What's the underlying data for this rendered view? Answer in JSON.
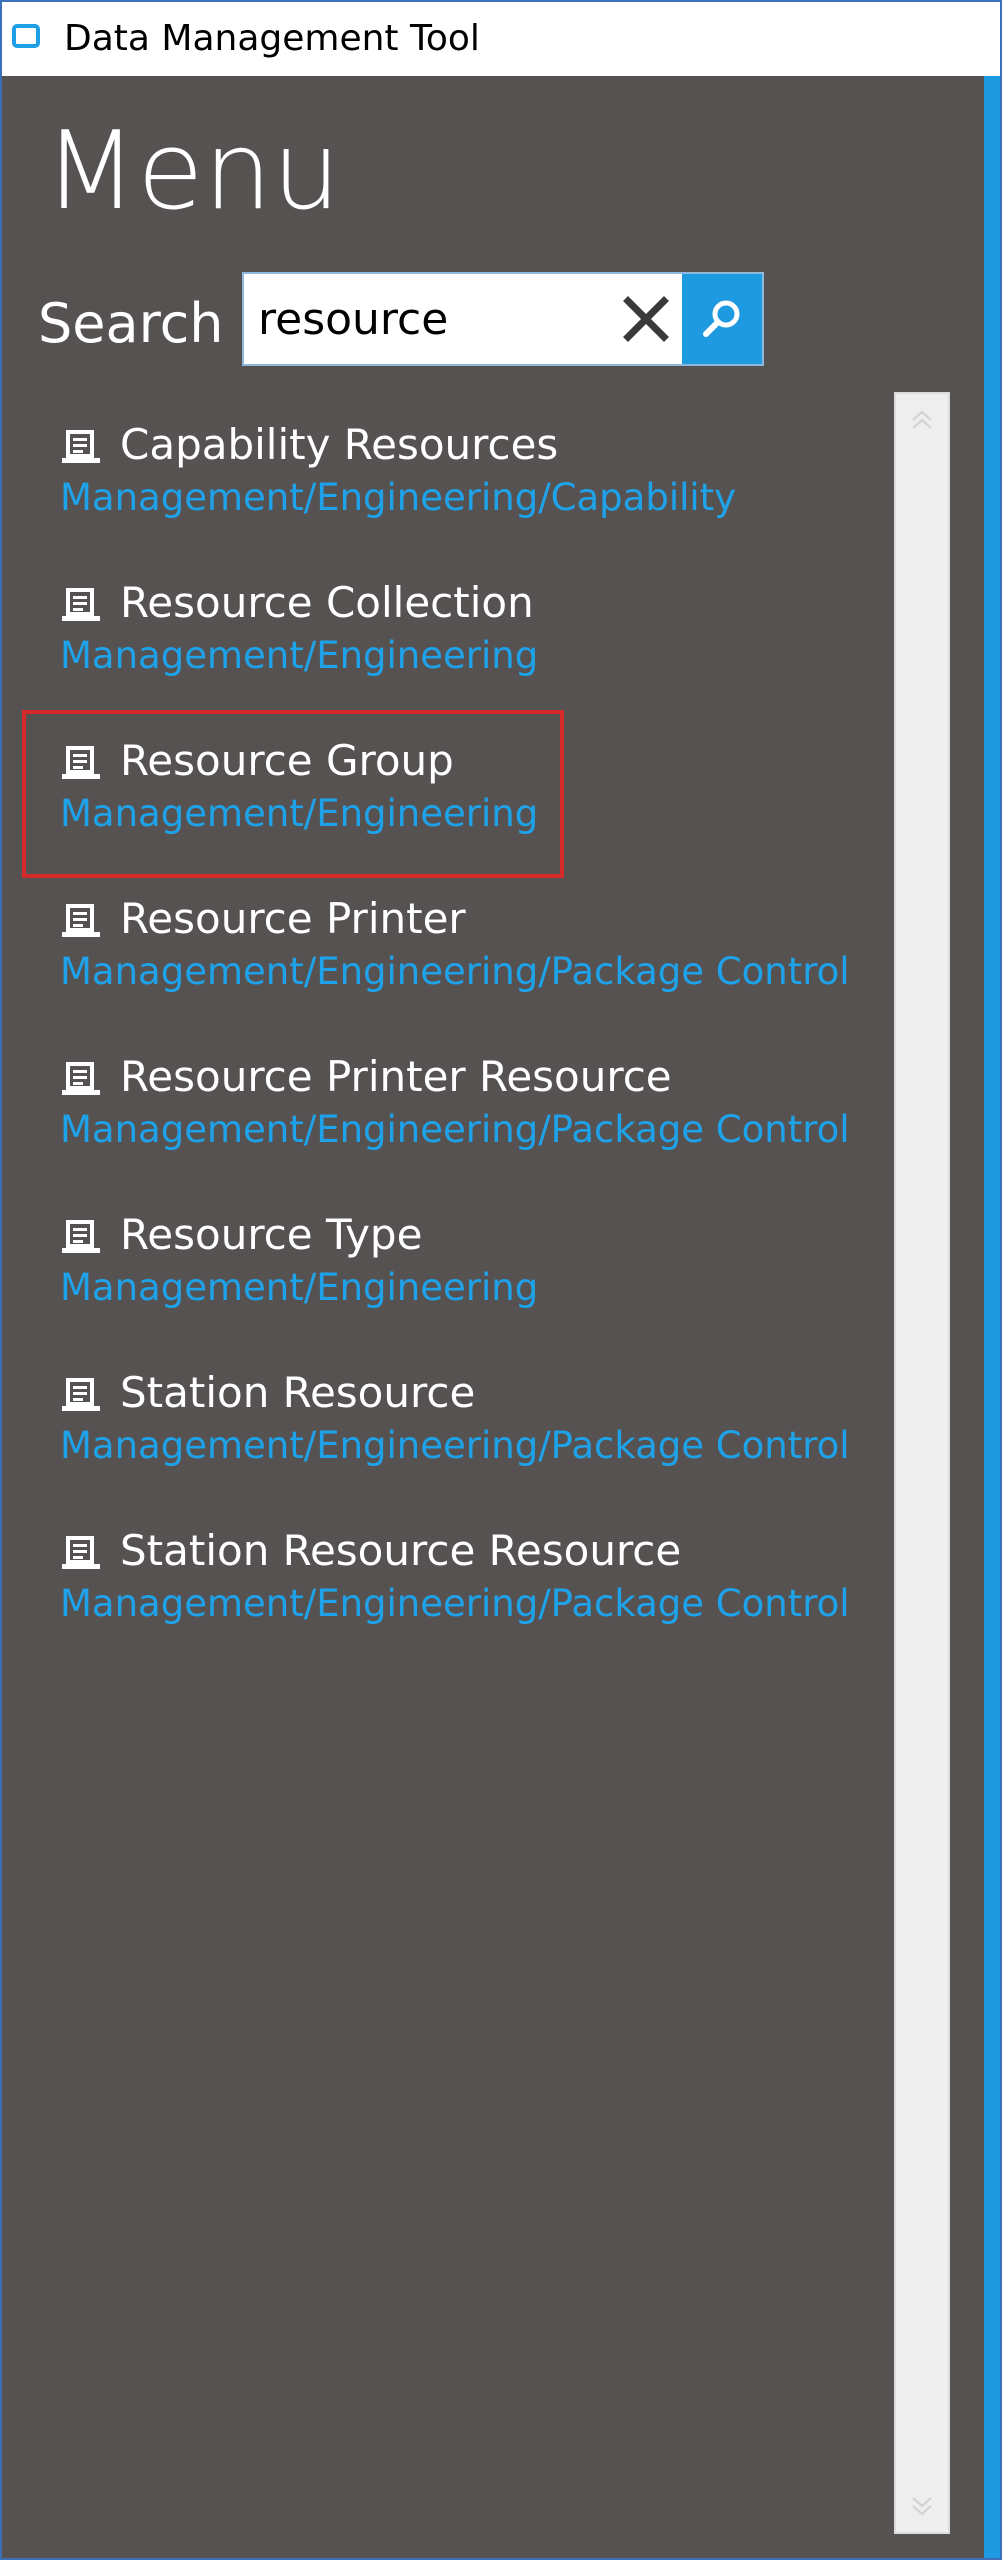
{
  "window": {
    "title": "Data Management Tool"
  },
  "menu": {
    "heading": "Menu"
  },
  "search": {
    "label": "Search",
    "value": "resource",
    "placeholder": ""
  },
  "results": [
    {
      "title": "Capability Resources",
      "path": "Management/Engineering/Capability"
    },
    {
      "title": "Resource Collection",
      "path": "Management/Engineering"
    },
    {
      "title": "Resource Group",
      "path": "Management/Engineering"
    },
    {
      "title": "Resource Printer",
      "path": "Management/Engineering/Package Control"
    },
    {
      "title": "Resource Printer Resource",
      "path": "Management/Engineering/Package Control"
    },
    {
      "title": "Resource Type",
      "path": "Management/Engineering"
    },
    {
      "title": "Station Resource",
      "path": "Management/Engineering/Package Control"
    },
    {
      "title": "Station Resource Resource",
      "path": "Management/Engineering/Package Control"
    }
  ],
  "colors": {
    "background": "#575252",
    "accent": "#1e9ae0",
    "path_text": "#1ea3ea",
    "highlight": "#d42a2a"
  },
  "icons": {
    "app": "app-window-icon",
    "clear": "close-icon",
    "search": "search-icon",
    "result": "document-icon",
    "scroll_up": "chevron-up-icon",
    "scroll_down": "chevron-down-icon"
  }
}
